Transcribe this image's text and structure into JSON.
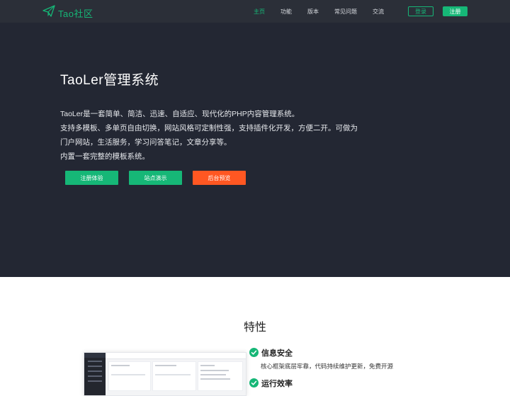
{
  "brand": {
    "logo_text": "Tao社区",
    "accent": "#16b777"
  },
  "nav": {
    "items": [
      {
        "label": "主页",
        "active": true
      },
      {
        "label": "功能",
        "active": false
      },
      {
        "label": "版本",
        "active": false
      },
      {
        "label": "常见问题",
        "active": false
      },
      {
        "label": "交流",
        "active": false
      }
    ],
    "login": "登录",
    "register": "注册"
  },
  "hero": {
    "title": "TaoLer管理系统",
    "lines": [
      "TaoLer是一套简单、简洁、迅速、自适应、现代化的PHP内容管理系统。",
      "支持多模板、多单页自由切换，网站风格可定制性强，支持插件化开发，方便二开。可做为",
      "门户网站，生活服务，学习问答笔记，文章分享等。",
      "内置一套完整的模板系统。"
    ],
    "buttons": {
      "register_trial": "注册体验",
      "site_demo": "站点演示",
      "admin_preview": "后台预览"
    },
    "colors": {
      "background": "#232733",
      "danger": "#ff5722"
    }
  },
  "features": {
    "title": "特性",
    "items": [
      {
        "title": "信息安全",
        "desc": "核心框架底层牢靠，代码持续维护更新，免费开源"
      },
      {
        "title": "运行效率",
        "desc": ""
      }
    ]
  }
}
